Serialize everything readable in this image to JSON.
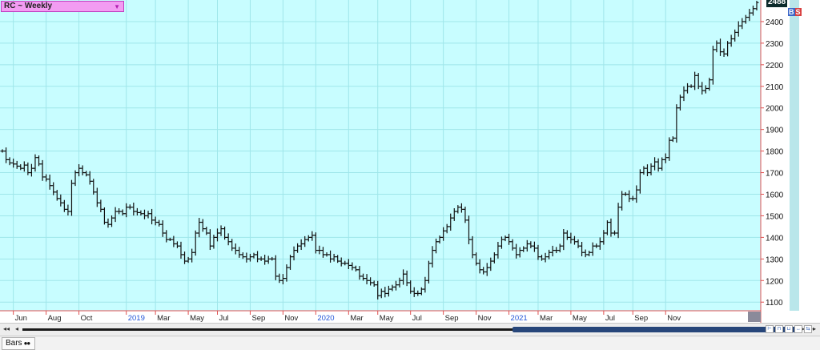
{
  "title": "RC ~ Weekly",
  "last_price": "2488",
  "badge": {
    "b": "B",
    "s": "S"
  },
  "status_tab": "Bars",
  "colors": {
    "background": "#c8fdff",
    "grid": "#9fe6ea",
    "bars": "#111111",
    "axis": "#e05050",
    "title_bg": "#f29cf2",
    "year_label": "#2356d8"
  },
  "chart_data": {
    "type": "ohlc",
    "title": "RC ~ Weekly",
    "xlabel": "",
    "ylabel": "",
    "ylim": [
      1060,
      2500
    ],
    "grid": true,
    "y_ticks": [
      1100,
      1200,
      1300,
      1400,
      1500,
      1600,
      1700,
      1800,
      1900,
      2000,
      2100,
      2200,
      2300,
      2400
    ],
    "x_labels": [
      {
        "text": "Jun",
        "week": 3,
        "year": false
      },
      {
        "text": "Aug",
        "week": 12,
        "year": false
      },
      {
        "text": "Oct",
        "week": 21,
        "year": false
      },
      {
        "text": "2019",
        "week": 34,
        "year": true
      },
      {
        "text": "Mar",
        "week": 42,
        "year": false
      },
      {
        "text": "May",
        "week": 51,
        "year": false
      },
      {
        "text": "Jul",
        "week": 59,
        "year": false
      },
      {
        "text": "Sep",
        "week": 68,
        "year": false
      },
      {
        "text": "Nov",
        "week": 77,
        "year": false
      },
      {
        "text": "2020",
        "week": 86,
        "year": true
      },
      {
        "text": "Mar",
        "week": 95,
        "year": false
      },
      {
        "text": "May",
        "week": 103,
        "year": false
      },
      {
        "text": "Jul",
        "week": 112,
        "year": false
      },
      {
        "text": "Sep",
        "week": 121,
        "year": false
      },
      {
        "text": "Nov",
        "week": 130,
        "year": false
      },
      {
        "text": "2021",
        "week": 139,
        "year": true
      },
      {
        "text": "Mar",
        "week": 147,
        "year": false
      },
      {
        "text": "May",
        "week": 156,
        "year": false
      },
      {
        "text": "Jul",
        "week": 165,
        "year": false
      },
      {
        "text": "Sep",
        "week": 173,
        "year": false
      },
      {
        "text": "Nov",
        "week": 182,
        "year": false
      }
    ],
    "closes": [
      1800,
      1760,
      1745,
      1740,
      1730,
      1720,
      1735,
      1700,
      1720,
      1770,
      1740,
      1680,
      1670,
      1640,
      1610,
      1580,
      1560,
      1530,
      1520,
      1650,
      1700,
      1720,
      1700,
      1690,
      1660,
      1610,
      1560,
      1530,
      1470,
      1460,
      1490,
      1520,
      1520,
      1510,
      1540,
      1540,
      1520,
      1515,
      1510,
      1500,
      1510,
      1480,
      1470,
      1460,
      1420,
      1390,
      1390,
      1370,
      1360,
      1320,
      1290,
      1300,
      1330,
      1420,
      1470,
      1440,
      1420,
      1360,
      1400,
      1420,
      1440,
      1400,
      1380,
      1350,
      1340,
      1320,
      1310,
      1300,
      1310,
      1320,
      1300,
      1300,
      1290,
      1300,
      1300,
      1220,
      1200,
      1210,
      1260,
      1310,
      1340,
      1360,
      1370,
      1390,
      1400,
      1410,
      1340,
      1340,
      1320,
      1320,
      1300,
      1310,
      1290,
      1280,
      1280,
      1270,
      1260,
      1250,
      1220,
      1210,
      1200,
      1190,
      1180,
      1130,
      1150,
      1140,
      1160,
      1170,
      1180,
      1200,
      1230,
      1190,
      1150,
      1140,
      1140,
      1160,
      1200,
      1280,
      1340,
      1380,
      1400,
      1430,
      1450,
      1490,
      1520,
      1540,
      1530,
      1480,
      1390,
      1320,
      1280,
      1250,
      1240,
      1260,
      1290,
      1320,
      1360,
      1390,
      1400,
      1380,
      1350,
      1320,
      1340,
      1350,
      1370,
      1360,
      1350,
      1310,
      1300,
      1310,
      1330,
      1340,
      1340,
      1360,
      1420,
      1400,
      1390,
      1380,
      1360,
      1330,
      1320,
      1330,
      1360,
      1360,
      1380,
      1420,
      1470,
      1420,
      1420,
      1540,
      1600,
      1600,
      1580,
      1580,
      1620,
      1700,
      1720,
      1700,
      1730,
      1750,
      1720,
      1760,
      1770,
      1850,
      1860,
      2000,
      2050,
      2080,
      2100,
      2100,
      2150,
      2100,
      2080,
      2090,
      2130,
      2270,
      2300,
      2260,
      2250,
      2300,
      2320,
      2350,
      2380,
      2400,
      2420,
      2440,
      2460,
      2488
    ]
  }
}
